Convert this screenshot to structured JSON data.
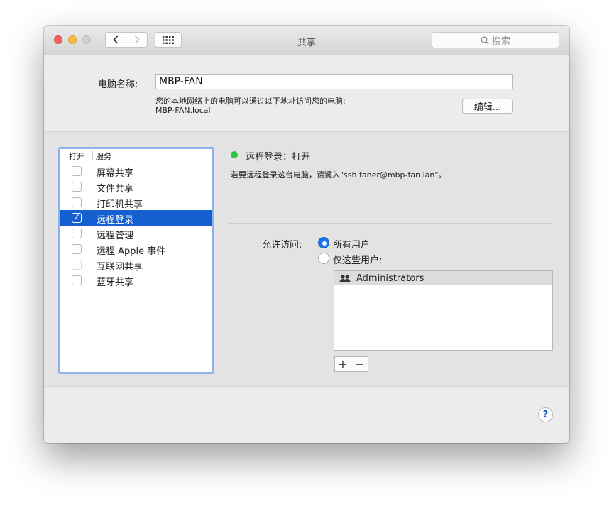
{
  "window": {
    "title": "共享",
    "search_placeholder": "搜索"
  },
  "computer_name": {
    "label": "电脑名称:",
    "value": "MBP-FAN",
    "address_note": "您的本地网络上的电脑可以通过以下地址访问您的电脑:",
    "address": "MBP-FAN.local",
    "edit_label": "编辑..."
  },
  "services": {
    "header_on": "打开",
    "header_service": "服务",
    "items": [
      {
        "label": "屏幕共享",
        "checked": false
      },
      {
        "label": "文件共享",
        "checked": false
      },
      {
        "label": "打印机共享",
        "checked": false
      },
      {
        "label": "远程登录",
        "checked": true,
        "selected": true
      },
      {
        "label": "远程管理",
        "checked": false
      },
      {
        "label": "远程 Apple 事件",
        "checked": false
      },
      {
        "label": "互联网共享",
        "checked": false
      },
      {
        "label": "蓝牙共享",
        "checked": false
      }
    ]
  },
  "detail": {
    "status": "远程登录：打开",
    "status_color": "#2cc63f",
    "description": "若要远程登录这台电脑，请键入\"ssh faner@mbp-fan.lan\"。",
    "allow_label": "允许访问:",
    "option_all": "所有用户",
    "option_some": "仅这些用户:",
    "selected_option": "所有用户",
    "users": [
      "Administrators"
    ],
    "add_label": "+",
    "remove_label": "−"
  },
  "help": "?",
  "colors": {
    "accent": "#1560d0",
    "list_focus": "#8cb4e9"
  }
}
